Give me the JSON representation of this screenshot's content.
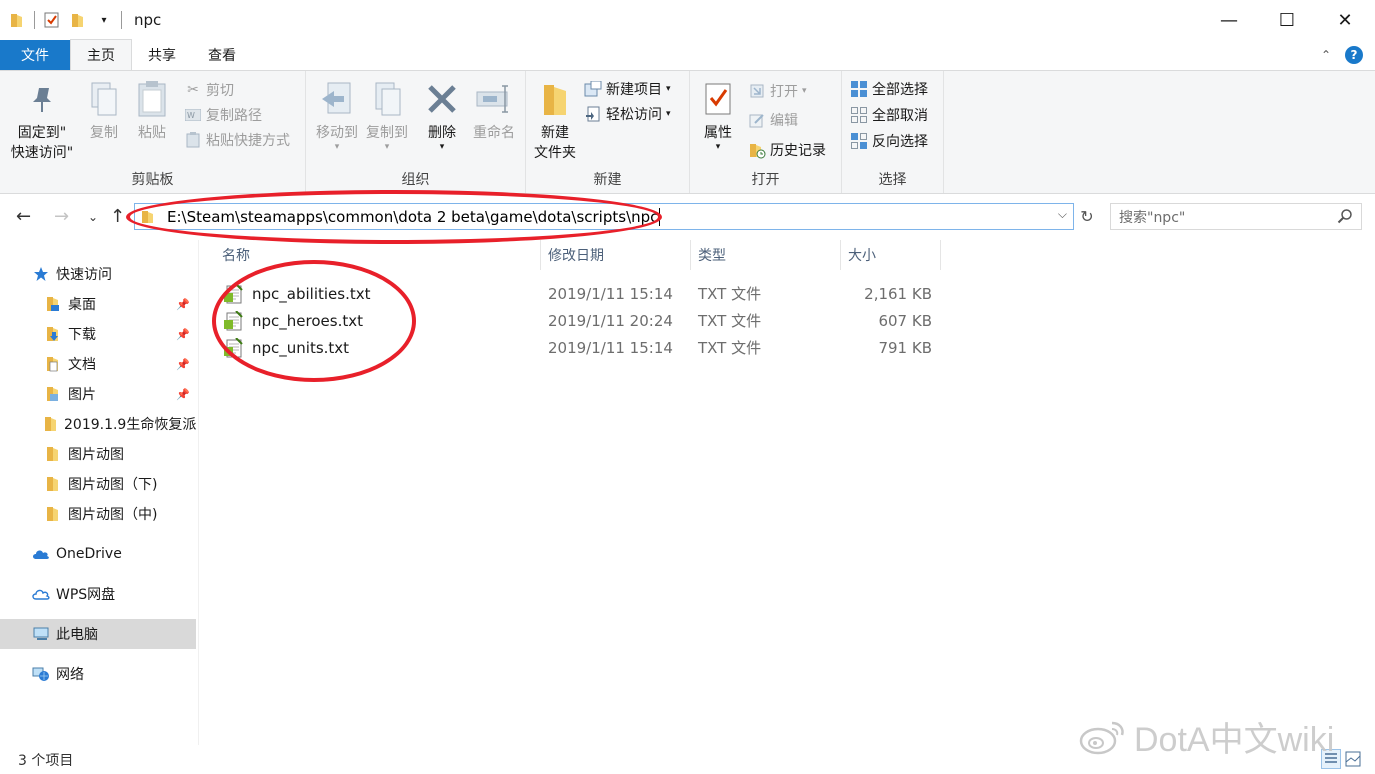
{
  "window": {
    "title": "npc",
    "minimize": "—",
    "maximize": "☐",
    "close": "✕"
  },
  "ribbon_tabs": {
    "file": "文件",
    "home": "主页",
    "share": "共享",
    "view": "查看"
  },
  "ribbon": {
    "clipboard": {
      "label": "剪贴板",
      "pin_line1": "固定到\"",
      "pin_line2": "快速访问\"",
      "copy": "复制",
      "paste": "粘贴",
      "cut": "剪切",
      "copy_path": "复制路径",
      "paste_shortcut": "粘贴快捷方式"
    },
    "organize": {
      "label": "组织",
      "move_to": "移动到",
      "copy_to": "复制到",
      "delete": "删除",
      "rename": "重命名"
    },
    "new": {
      "label": "新建",
      "new_folder_line1": "新建",
      "new_folder_line2": "文件夹",
      "new_item": "新建项目",
      "easy_access": "轻松访问"
    },
    "open": {
      "label": "打开",
      "properties": "属性",
      "open": "打开",
      "edit": "编辑",
      "history": "历史记录"
    },
    "select": {
      "label": "选择",
      "select_all": "全部选择",
      "select_none": "全部取消",
      "invert": "反向选择"
    }
  },
  "address": {
    "path": "E:\\Steam\\steamapps\\common\\dota 2 beta\\game\\dota\\scripts\\npc",
    "search_placeholder": "搜索\"npc\""
  },
  "sidebar": {
    "items": [
      {
        "label": "快速访问",
        "icon": "star-icon"
      },
      {
        "label": "桌面",
        "icon": "desktop-folder-icon",
        "pinned": true
      },
      {
        "label": "下载",
        "icon": "download-folder-icon",
        "pinned": true
      },
      {
        "label": "文档",
        "icon": "documents-folder-icon",
        "pinned": true
      },
      {
        "label": "图片",
        "icon": "pictures-folder-icon",
        "pinned": true
      },
      {
        "label": "2019.1.9生命恢复派",
        "icon": "folder-icon"
      },
      {
        "label": "图片动图",
        "icon": "folder-icon"
      },
      {
        "label": "图片动图（下)",
        "icon": "folder-icon"
      },
      {
        "label": "图片动图（中)",
        "icon": "folder-icon"
      },
      {
        "label": "OneDrive",
        "icon": "onedrive-icon"
      },
      {
        "label": "WPS网盘",
        "icon": "wps-cloud-icon"
      },
      {
        "label": "此电脑",
        "icon": "computer-icon"
      },
      {
        "label": "网络",
        "icon": "network-icon"
      }
    ]
  },
  "file_list": {
    "columns": {
      "name": "名称",
      "modified": "修改日期",
      "type": "类型",
      "size": "大小"
    },
    "rows": [
      {
        "name": "npc_abilities.txt",
        "modified": "2019/1/11 15:14",
        "type": "TXT 文件",
        "size": "2,161 KB"
      },
      {
        "name": "npc_heroes.txt",
        "modified": "2019/1/11 20:24",
        "type": "TXT 文件",
        "size": "607 KB"
      },
      {
        "name": "npc_units.txt",
        "modified": "2019/1/11 15:14",
        "type": "TXT 文件",
        "size": "791 KB"
      }
    ]
  },
  "status": {
    "count": "3 个项目"
  },
  "watermark": {
    "text": "DotA中文wiki"
  },
  "colors": {
    "accent": "#1979ca",
    "annotation": "#e8202a"
  }
}
